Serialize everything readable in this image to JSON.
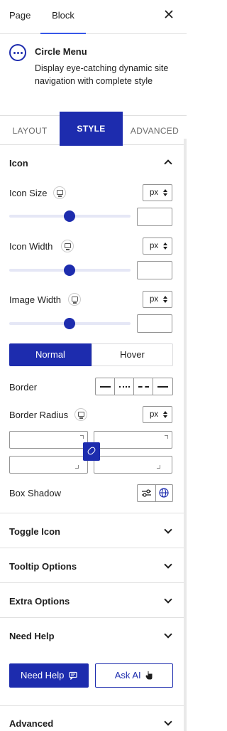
{
  "header": {
    "tabs": [
      {
        "label": "Page",
        "active": false
      },
      {
        "label": "Block",
        "active": true
      }
    ],
    "close_icon": "close-icon"
  },
  "block": {
    "icon": "ellipsis-circle-icon",
    "title": "Circle Menu",
    "description": "Display eye-catching dynamic site navigation with complete style"
  },
  "style_tabs": [
    {
      "label": "LAYOUT",
      "active": false
    },
    {
      "label": "STYLE",
      "active": true
    },
    {
      "label": "ADVANCED",
      "active": false
    }
  ],
  "icon_panel": {
    "title": "Icon",
    "expanded": true,
    "controls": [
      {
        "label": "Icon Size",
        "unit": "px",
        "value": "",
        "slider_fraction": 0.5
      },
      {
        "label": "Icon Width",
        "unit": "px",
        "value": "",
        "slider_fraction": 0.5
      },
      {
        "label": "Image Width",
        "unit": "px",
        "value": "",
        "slider_fraction": 0.5
      }
    ],
    "state_toggle": {
      "normal": "Normal",
      "hover": "Hover",
      "active": "normal"
    },
    "border_label": "Border",
    "border_styles": [
      "solid",
      "dotted",
      "dashed",
      "double"
    ],
    "border_radius_label": "Border Radius",
    "border_radius_unit": "px",
    "radius_values": [
      "",
      "",
      "",
      ""
    ],
    "box_shadow_label": "Box Shadow"
  },
  "collapsed_panels": [
    {
      "title": "Toggle Icon"
    },
    {
      "title": "Tooltip Options"
    },
    {
      "title": "Extra Options"
    }
  ],
  "help_panel": {
    "title": "Need Help",
    "need_help_button": "Need Help",
    "ask_ai_button": "Ask AI"
  },
  "advanced_panel": {
    "title": "Advanced"
  },
  "colors": {
    "accent": "#1d2cae",
    "wp_blue": "#3858e9",
    "border": "#e0e0e0"
  }
}
